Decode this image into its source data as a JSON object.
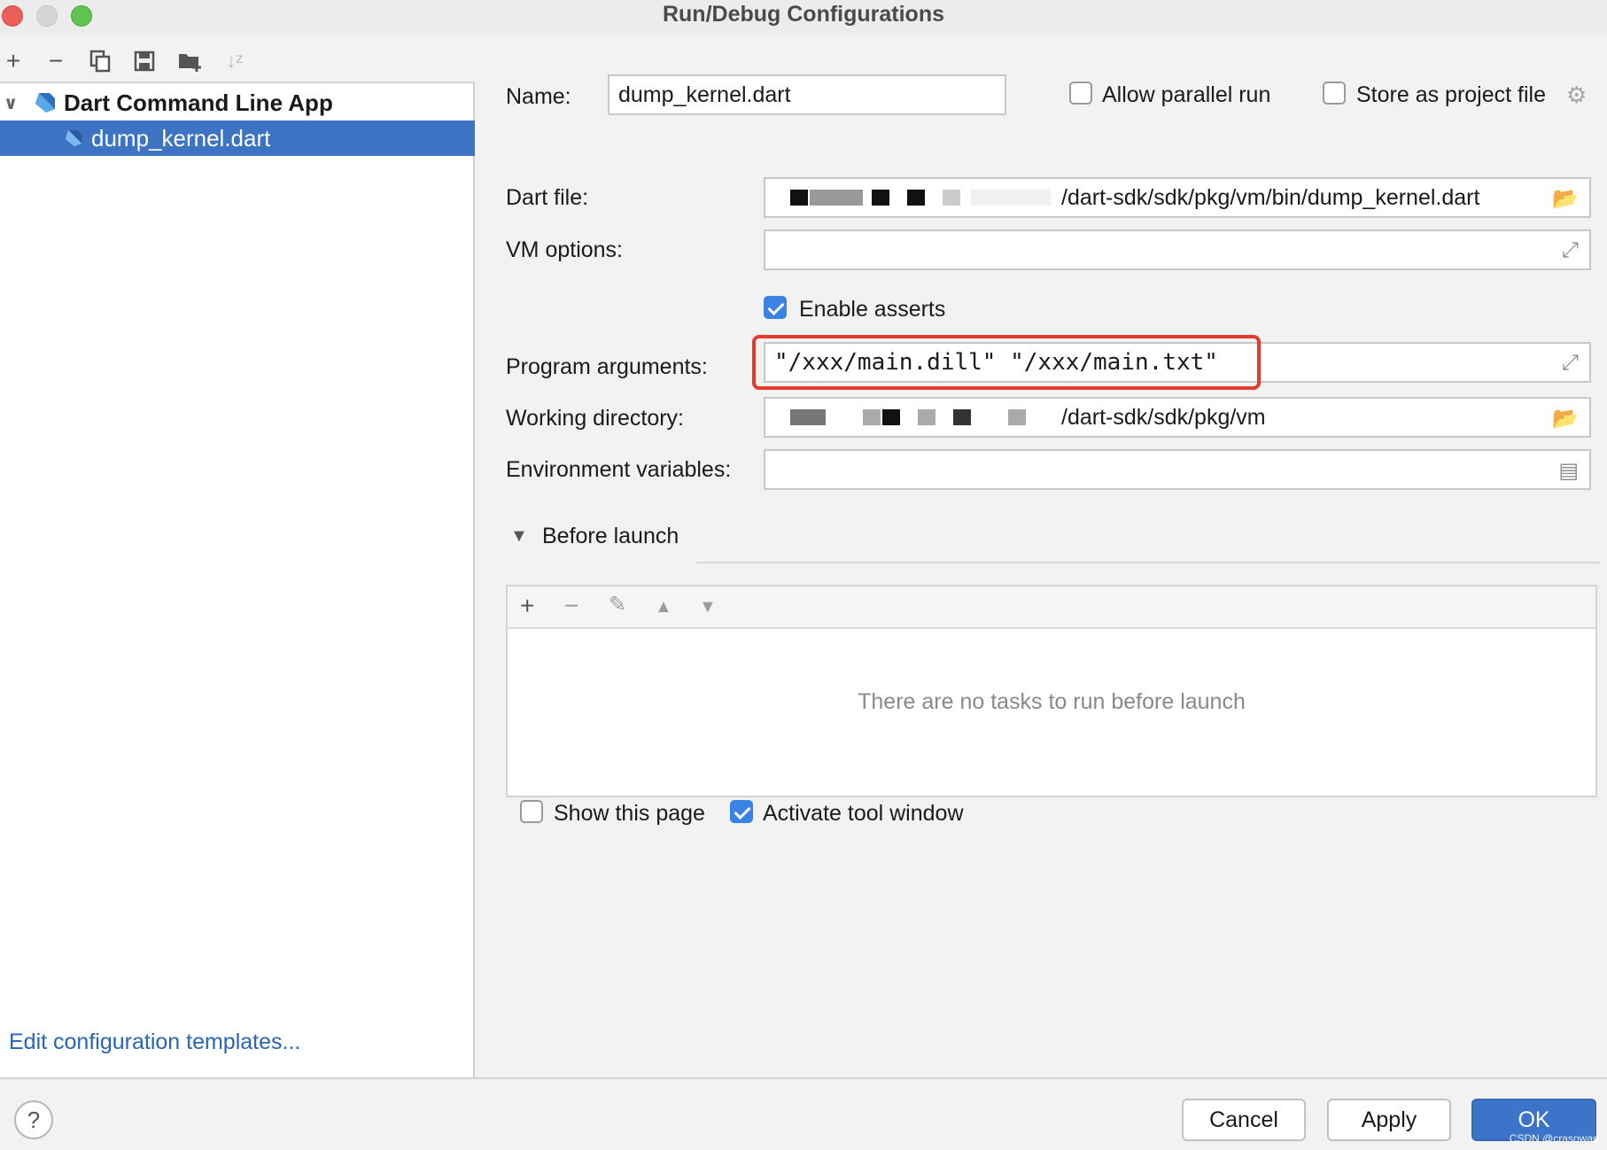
{
  "window": {
    "title": "Run/Debug Configurations"
  },
  "left_panel": {
    "toolbar_icons": [
      "add-icon",
      "remove-icon",
      "copy-icon",
      "save-icon",
      "folder-add-icon",
      "sort-icon"
    ],
    "tree": {
      "group_label": "Dart Command Line App",
      "selected_item_label": "dump_kernel.dart"
    },
    "edit_templates_link": "Edit configuration templates..."
  },
  "form": {
    "name_label": "Name:",
    "name_value": "dump_kernel.dart",
    "allow_parallel_label": "Allow parallel run",
    "allow_parallel_checked": false,
    "store_project_label": "Store as project file",
    "store_project_checked": false,
    "dart_file_label": "Dart file:",
    "dart_file_value": "/dart-sdk/sdk/pkg/vm/bin/dump_kernel.dart",
    "vm_options_label": "VM options:",
    "vm_options_value": "",
    "enable_asserts_label": "Enable asserts",
    "enable_asserts_checked": true,
    "program_args_label": "Program arguments:",
    "program_args_value": "\"/xxx/main.dill\" \"/xxx/main.txt\"",
    "working_dir_label": "Working directory:",
    "working_dir_value": "/dart-sdk/sdk/pkg/vm",
    "env_vars_label": "Environment variables:",
    "env_vars_value": ""
  },
  "before_launch": {
    "title": "Before launch",
    "empty_message": "There are no tasks to run before launch",
    "show_page_label": "Show this page",
    "show_page_checked": false,
    "activate_tool_label": "Activate tool window",
    "activate_tool_checked": true
  },
  "footer": {
    "help_label": "?",
    "cancel_label": "Cancel",
    "apply_label": "Apply",
    "ok_label": "OK",
    "watermark": "CSDN @crasowas"
  },
  "colors": {
    "selection": "#3d73c3",
    "link": "#2a64b8",
    "highlight": "#e53a2e",
    "checkbox_checked": "#3b82e6",
    "primary_button": "#3b74c9"
  }
}
